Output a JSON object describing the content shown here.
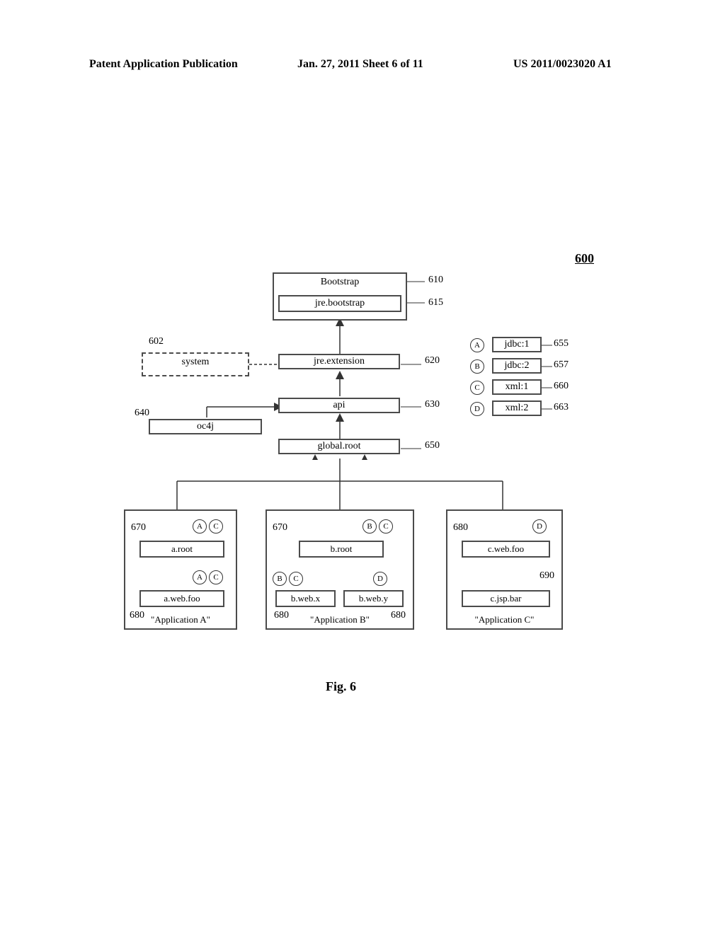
{
  "header": {
    "left": "Patent Application Publication",
    "middle": "Jan. 27, 2011   Sheet 6 of 11",
    "right": "US 2011/0023020 A1"
  },
  "figref": "600",
  "figcaption": "Fig. 6",
  "nodes": {
    "bootstrap_title": "Bootstrap",
    "bootstrap_inner": "jre.bootstrap",
    "jre_extension": "jre.extension",
    "system": "system",
    "api": "api",
    "oc4j": "oc4j",
    "global_root": "global.root",
    "jdbc1": "jdbc:1",
    "jdbc2": "jdbc:2",
    "xml1": "xml:1",
    "xml2": "xml:2"
  },
  "refs": {
    "bootstrap": "610",
    "bootstrap_inner": "615",
    "system": "602",
    "jre_ext": "620",
    "api": "630",
    "oc4j": "640",
    "global_root": "650",
    "jdbc1": "655",
    "jdbc2": "657",
    "xml1": "660",
    "xml2": "663",
    "appA_root": "670",
    "appB_root": "670",
    "appA_sub": "680",
    "appB_subx": "680",
    "appB_suby": "680",
    "appC_web": "680",
    "appC_jsp": "690"
  },
  "apps": {
    "A": {
      "root": "a.root",
      "sub1": "a.web.foo",
      "caption": "\"Application A\""
    },
    "B": {
      "root": "b.root",
      "subx": "b.web.x",
      "suby": "b.web.y",
      "caption": "\"Application B\""
    },
    "C": {
      "web": "c.web.foo",
      "jsp": "c.jsp.bar",
      "caption": "\"Application C\""
    }
  },
  "letters": {
    "A": "A",
    "B": "B",
    "C": "C",
    "D": "D"
  }
}
